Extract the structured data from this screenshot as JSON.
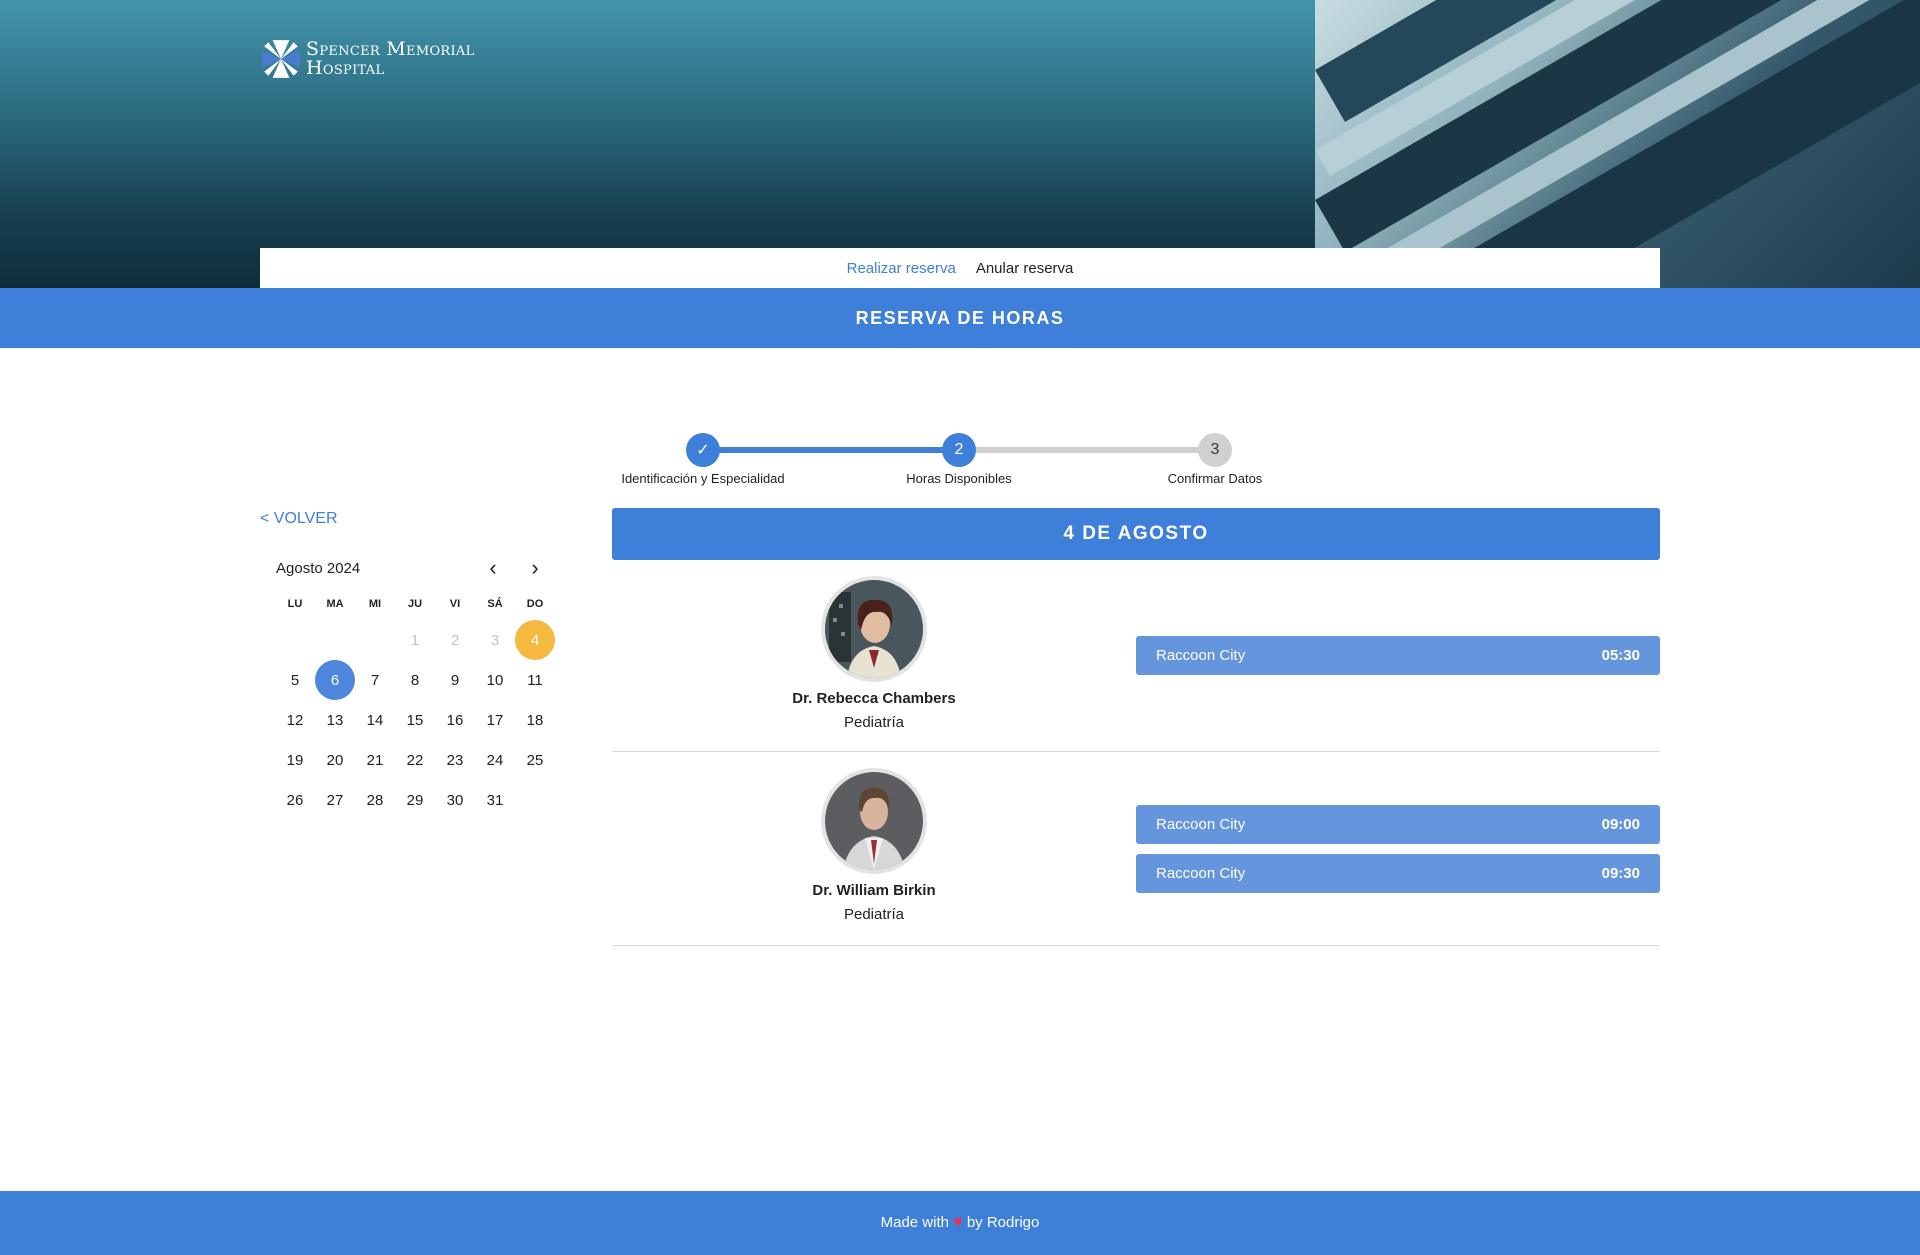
{
  "brand": {
    "line1": "Spencer Memorial",
    "line2": "Hospital"
  },
  "nav": {
    "items": [
      {
        "label": "Realizar reserva"
      },
      {
        "label": "Anular reserva"
      }
    ]
  },
  "page_title": "RESERVA DE HORAS",
  "stepper": {
    "steps": [
      {
        "label": "Identificación y Especialidad",
        "marker": "✓"
      },
      {
        "label": "Horas Disponibles",
        "marker": "2"
      },
      {
        "label": "Confirmar Datos",
        "marker": "3"
      }
    ]
  },
  "back_label": "< VOLVER",
  "calendar": {
    "month_label": "Agosto 2024",
    "prev_icon": "‹",
    "next_icon": "›",
    "weekdays": [
      "LU",
      "MA",
      "MI",
      "JU",
      "VI",
      "SÁ",
      "DO"
    ],
    "days": [
      {
        "n": "",
        "state": "empty"
      },
      {
        "n": "",
        "state": "empty"
      },
      {
        "n": "",
        "state": "empty"
      },
      {
        "n": "1",
        "state": "muted"
      },
      {
        "n": "2",
        "state": "muted"
      },
      {
        "n": "3",
        "state": "muted"
      },
      {
        "n": "4",
        "state": "selected"
      },
      {
        "n": "5",
        "state": "normal"
      },
      {
        "n": "6",
        "state": "today"
      },
      {
        "n": "7",
        "state": "normal"
      },
      {
        "n": "8",
        "state": "normal"
      },
      {
        "n": "9",
        "state": "normal"
      },
      {
        "n": "10",
        "state": "normal"
      },
      {
        "n": "11",
        "state": "normal"
      },
      {
        "n": "12",
        "state": "normal"
      },
      {
        "n": "13",
        "state": "normal"
      },
      {
        "n": "14",
        "state": "normal"
      },
      {
        "n": "15",
        "state": "normal"
      },
      {
        "n": "16",
        "state": "normal"
      },
      {
        "n": "17",
        "state": "normal"
      },
      {
        "n": "18",
        "state": "normal"
      },
      {
        "n": "19",
        "state": "normal"
      },
      {
        "n": "20",
        "state": "normal"
      },
      {
        "n": "21",
        "state": "normal"
      },
      {
        "n": "22",
        "state": "normal"
      },
      {
        "n": "23",
        "state": "normal"
      },
      {
        "n": "24",
        "state": "normal"
      },
      {
        "n": "25",
        "state": "normal"
      },
      {
        "n": "26",
        "state": "normal"
      },
      {
        "n": "27",
        "state": "normal"
      },
      {
        "n": "28",
        "state": "normal"
      },
      {
        "n": "29",
        "state": "normal"
      },
      {
        "n": "30",
        "state": "normal"
      },
      {
        "n": "31",
        "state": "normal"
      }
    ]
  },
  "selected_date_label": "4 DE AGOSTO",
  "doctors": [
    {
      "name": "Dr. Rebecca Chambers",
      "specialty": "Pediatría",
      "slots": [
        {
          "location": "Raccoon City",
          "time": "05:30"
        }
      ]
    },
    {
      "name": "Dr. William Birkin",
      "specialty": "Pediatría",
      "slots": [
        {
          "location": "Raccoon City",
          "time": "09:00"
        },
        {
          "location": "Raccoon City",
          "time": "09:30"
        }
      ]
    }
  ],
  "footer": {
    "prefix": "Made with",
    "heart": "♥",
    "suffix": "by Rodrigo"
  },
  "colors": {
    "primary": "#3d7fd9",
    "slot": "#6495dd",
    "selected_day": "#f5b942",
    "today_day": "#4f86dd",
    "inactive_step": "#d0d0d0"
  }
}
